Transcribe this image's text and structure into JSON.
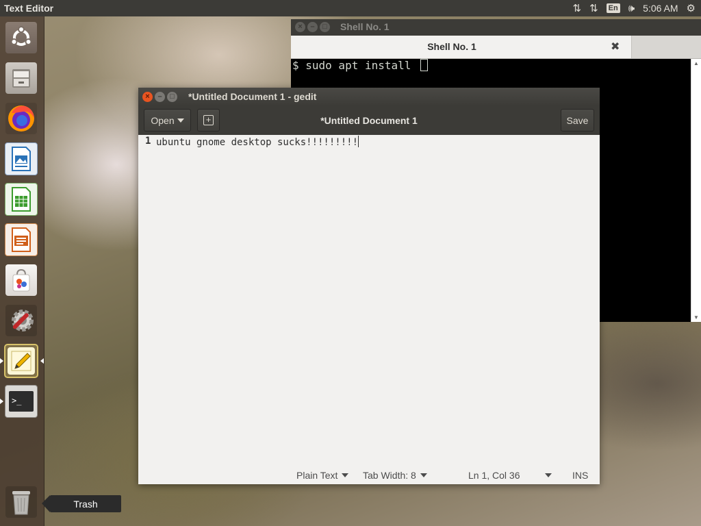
{
  "top_panel": {
    "app_title": "Text Editor",
    "language": "En",
    "clock": "5:06 AM"
  },
  "launcher": {
    "items": [
      {
        "name": "Ubuntu Dash"
      },
      {
        "name": "Files"
      },
      {
        "name": "Firefox"
      },
      {
        "name": "LibreOffice Writer"
      },
      {
        "name": "LibreOffice Calc"
      },
      {
        "name": "LibreOffice Impress"
      },
      {
        "name": "Ubuntu Software"
      },
      {
        "name": "System Settings"
      },
      {
        "name": "Text Editor"
      },
      {
        "name": "Terminal"
      }
    ],
    "trash_tooltip": "Trash"
  },
  "terminal": {
    "window_title": "Shell No. 1",
    "tab_label": "Shell No. 1",
    "tab_close": "✖",
    "prompt_line": "$ sudo apt install "
  },
  "gedit": {
    "window_title": "*Untitled Document 1 - gedit",
    "open_label": "Open",
    "new_tab_label": "+",
    "header_title": "*Untitled Document 1",
    "save_label": "Save",
    "line_number": "1",
    "text": "ubuntu gnome desktop sucks!!!!!!!!!",
    "status": {
      "language": "Plain Text",
      "tab_width": "Tab Width: 8",
      "position": "Ln 1, Col 36",
      "mode": "INS"
    }
  },
  "colors": {
    "panel": "#3c3b37",
    "close_button": "#e95420",
    "editor_bg": "#f2f1ef",
    "terminal_bg": "#000000"
  }
}
